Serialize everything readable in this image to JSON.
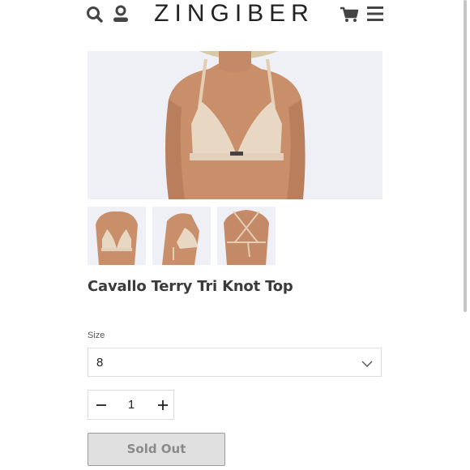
{
  "header": {
    "logo": "ZINGIBER",
    "icons": [
      "search-icon",
      "account-icon",
      "cart-icon",
      "menu-icon"
    ]
  },
  "product": {
    "title": "Cavallo Terry Tri Knot Top",
    "size_label": "Size",
    "size_value": "8",
    "quantity": "1",
    "sold_out_label": "Sold Out"
  },
  "colors": {
    "image_bg": "#eef0f6",
    "button_bg": "#e0e0e0",
    "text": "#333333"
  }
}
